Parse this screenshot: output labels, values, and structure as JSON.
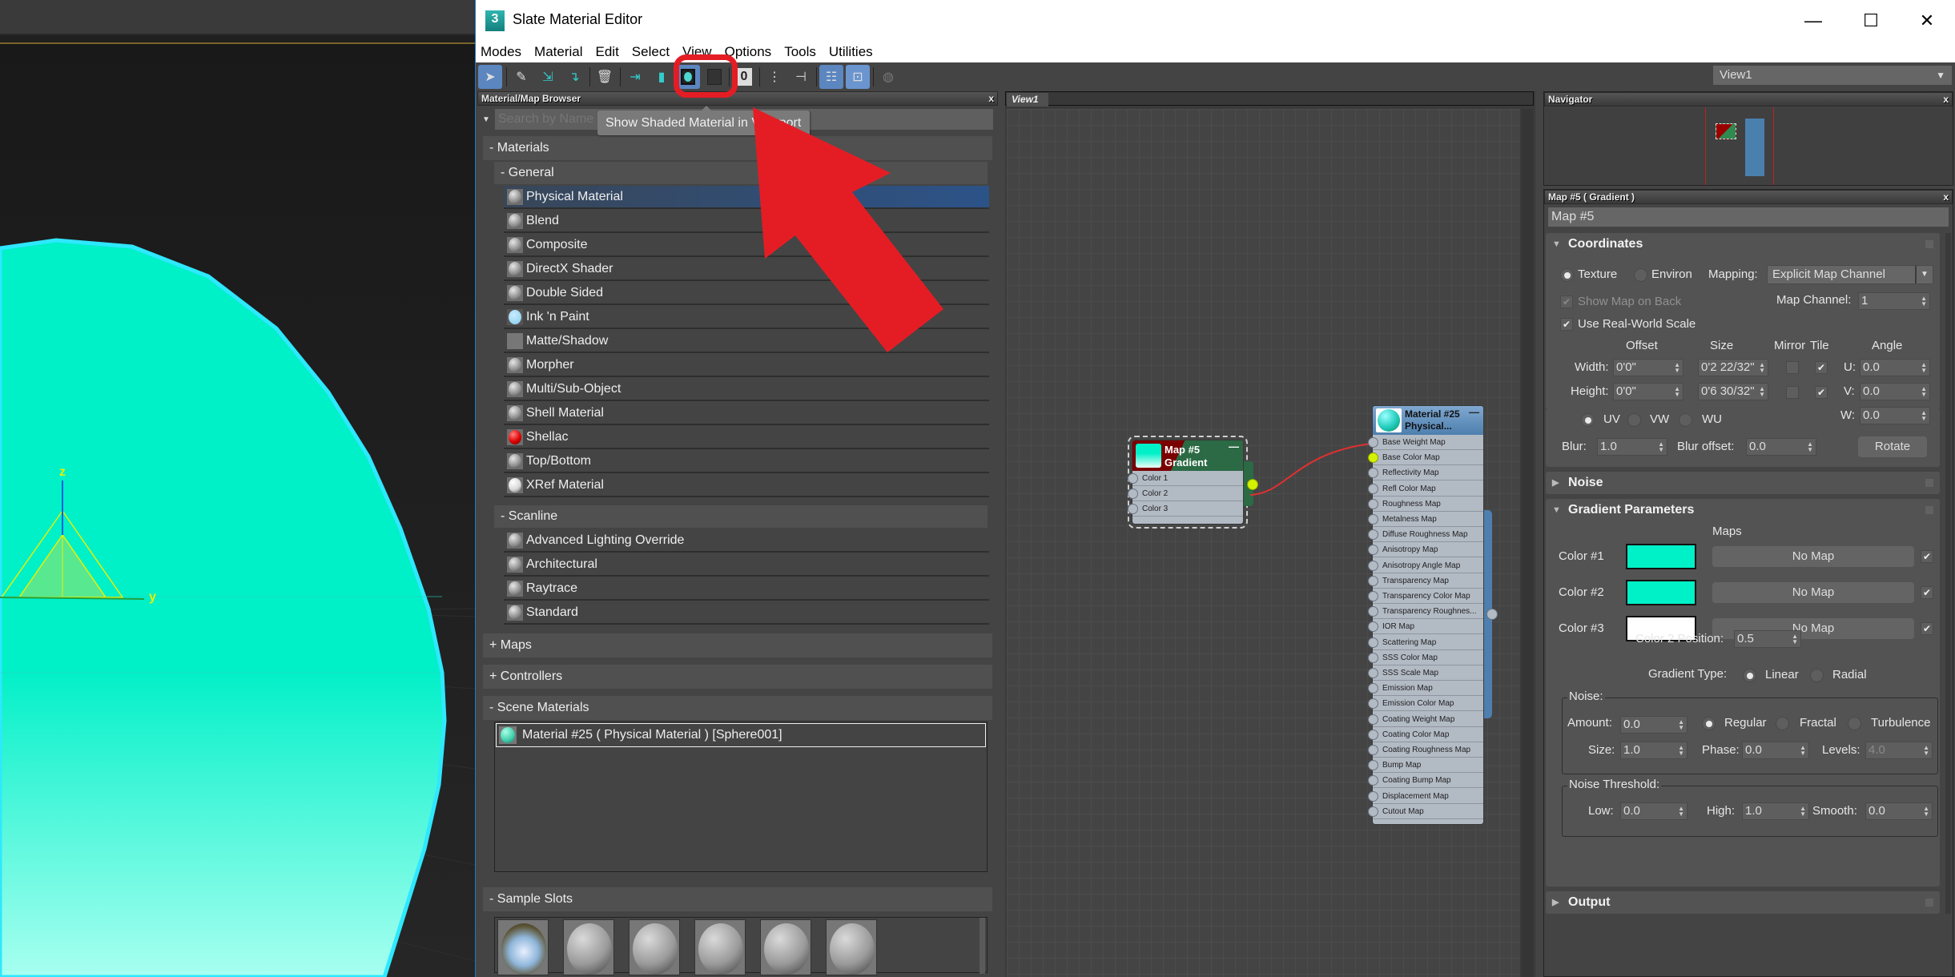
{
  "window": {
    "title": "Slate Material Editor",
    "controls": {
      "minimize": "—",
      "maximize": "☐",
      "close": "✕"
    }
  },
  "menu": [
    "Modes",
    "Material",
    "Edit",
    "Select",
    "View",
    "Options",
    "Tools",
    "Utilities"
  ],
  "toolbar": {
    "tooltip": "Show Shaded Material in Viewport",
    "view_select": "View1",
    "buttons": [
      {
        "name": "select-tool",
        "icon": "pointer-arrow",
        "active": true
      },
      {
        "name": "pick-material",
        "icon": "eyedropper"
      },
      {
        "name": "put-to-scene",
        "icon": "put-to-scene"
      },
      {
        "name": "assign-to-selection",
        "icon": "assign-material"
      },
      {
        "name": "delete-selected",
        "icon": "trash"
      },
      {
        "name": "move-children",
        "icon": "move-children"
      },
      {
        "name": "hide-unused-slots",
        "icon": "hide-slots"
      },
      {
        "name": "show-shaded-material",
        "icon": "checker-sphere",
        "active": true
      },
      {
        "name": "show-realistic-material",
        "icon": "checker-sphere-dark"
      },
      {
        "name": "show-background",
        "icon": "zero-box",
        "label": "0"
      },
      {
        "name": "layout-all",
        "icon": "layout"
      },
      {
        "name": "layout-children",
        "icon": "layout-children"
      },
      {
        "name": "material-map-browser",
        "icon": "browser",
        "active": true
      },
      {
        "name": "parameter-editor",
        "icon": "parameter-editor",
        "active": true
      },
      {
        "name": "select-by-material",
        "icon": "select-by-material"
      }
    ]
  },
  "browser": {
    "title": "Material/Map Browser",
    "close": "x",
    "search_placeholder": "Search by Name ...",
    "groups": {
      "materials": "- Materials",
      "general": "- General",
      "general_items": [
        {
          "label": "Physical Material",
          "icon": "gray",
          "selected": true
        },
        {
          "label": "Blend",
          "icon": "gray"
        },
        {
          "label": "Composite",
          "icon": "gray"
        },
        {
          "label": "DirectX Shader",
          "icon": "gray"
        },
        {
          "label": "Double Sided",
          "icon": "gray"
        },
        {
          "label": "Ink 'n Paint",
          "icon": "lightblue"
        },
        {
          "label": "Matte/Shadow",
          "icon": "flat"
        },
        {
          "label": "Morpher",
          "icon": "gray"
        },
        {
          "label": "Multi/Sub-Object",
          "icon": "gray"
        },
        {
          "label": "Shell Material",
          "icon": "gray"
        },
        {
          "label": "Shellac",
          "icon": "red"
        },
        {
          "label": "Top/Bottom",
          "icon": "gray"
        },
        {
          "label": "XRef Material",
          "icon": "white"
        }
      ],
      "scanline": "- Scanline",
      "scanline_items": [
        {
          "label": "Advanced Lighting Override"
        },
        {
          "label": "Architectural"
        },
        {
          "label": "Raytrace"
        },
        {
          "label": "Standard"
        }
      ],
      "maps": "+ Maps",
      "controllers": "+ Controllers",
      "scene_materials": "- Scene Materials",
      "scene_items": [
        "Material #25  ( Physical Material )  [Sphere001]"
      ],
      "sample_slots": "- Sample Slots",
      "slot_count_visible": 6
    }
  },
  "graph": {
    "tab": "View1",
    "map_node": {
      "title": "Map #5",
      "subtitle": "Gradient",
      "inputs": [
        "Color 1",
        "Color 2",
        "Color 3"
      ],
      "collapse": "—"
    },
    "material_node": {
      "title": "Material #25",
      "subtitle": "Physical...",
      "collapse": "—",
      "connected_input": "Base Color Map",
      "inputs": [
        "Base Weight Map",
        "Base Color Map",
        "Reflectivity Map",
        "Refl Color Map",
        "Roughness Map",
        "Metalness Map",
        "Diffuse Roughness Map",
        "Anisotropy Map",
        "Anisotropy Angle Map",
        "Transparency Map",
        "Transparency Color Map",
        "Transparency Roughnes...",
        "IOR Map",
        "Scattering Map",
        "SSS Color Map",
        "SSS Scale Map",
        "Emission Map",
        "Emission Color Map",
        "Coating Weight Map",
        "Coating Color Map",
        "Coating Roughness Map",
        "Bump Map",
        "Coating Bump Map",
        "Displacement Map",
        "Cutout Map"
      ]
    }
  },
  "navigator": {
    "title": "Navigator",
    "close": "x"
  },
  "params": {
    "panel_title": "Map #5  ( Gradient )",
    "close": "x",
    "name_field": "Map #5",
    "coordinates": {
      "title": "Coordinates",
      "texture": "Texture",
      "environ": "Environ",
      "mapping_label": "Mapping:",
      "mapping_value": "Explicit Map Channel",
      "show_map_on_back": "Show Map on Back",
      "map_channel_label": "Map Channel:",
      "map_channel": "1",
      "use_real_world": "Use Real-World Scale",
      "col_offset": "Offset",
      "col_size": "Size",
      "col_mirror": "Mirror",
      "col_tile": "Tile",
      "col_angle": "Angle",
      "width_label": "Width:",
      "height_label": "Height:",
      "width_offset": "0'0\"",
      "height_offset": "0'0\"",
      "width_size": "0'2 22/32\"",
      "height_size": "0'6 30/32\"",
      "u_label": "U:",
      "v_label": "V:",
      "w_label": "W:",
      "u": "0.0",
      "v": "0.0",
      "w": "0.0",
      "uv": "UV",
      "vw": "VW",
      "wu": "WU",
      "blur_label": "Blur:",
      "blur": "1.0",
      "blur_offset_label": "Blur offset:",
      "blur_offset": "0.0",
      "rotate": "Rotate"
    },
    "noise_rollout": "Noise",
    "gradient": {
      "title": "Gradient Parameters",
      "maps_header": "Maps",
      "colors": [
        {
          "label": "Color #1",
          "hex": "#00f0c8",
          "map": "No Map"
        },
        {
          "label": "Color #2",
          "hex": "#00f0c8",
          "map": "No Map"
        },
        {
          "label": "Color #3",
          "hex": "#ffffff",
          "map": "No Map"
        }
      ],
      "pos_label": "Color 2 Position:",
      "pos": "0.5",
      "type_label": "Gradient Type:",
      "linear": "Linear",
      "radial": "Radial",
      "noise_group": "Noise:",
      "amount_label": "Amount:",
      "amount": "0.0",
      "regular": "Regular",
      "fractal": "Fractal",
      "turbulence": "Turbulence",
      "size_label": "Size:",
      "size": "1.0",
      "phase_label": "Phase:",
      "phase": "0.0",
      "levels_label": "Levels:",
      "levels": "4.0",
      "threshold_group": "Noise Threshold:",
      "low_label": "Low:",
      "low": "0.0",
      "high_label": "High:",
      "high": "1.0",
      "smooth_label": "Smooth:",
      "smooth": "0.0"
    },
    "output_rollout": "Output"
  },
  "viewport": {
    "axis_labels": {
      "z": "z",
      "y": "y"
    },
    "sphere_color": "#00f0c8"
  },
  "colors": {
    "accent_blue": "#5b86c0",
    "highlight_red": "#e41d25",
    "socket_live": "#d4f200"
  }
}
